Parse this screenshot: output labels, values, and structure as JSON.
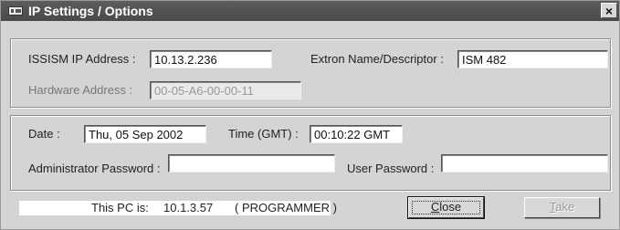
{
  "window": {
    "title": "IP Settings / Options",
    "close_glyph": "×"
  },
  "network": {
    "ip_label": "ISSISM IP Address :",
    "ip_value": "10.13.2.236",
    "name_label": "Extron Name/Descriptor :",
    "name_value": "ISM 482",
    "hw_label": "Hardware Address :",
    "hw_value": "00-05-A6-00-00-11"
  },
  "clock": {
    "date_label": "Date :",
    "date_value": "Thu, 05 Sep 2002",
    "time_label": "Time (GMT) :",
    "time_value": "00:10:22 GMT",
    "admin_pw_label": "Administrator Password :",
    "admin_pw_value": "",
    "user_pw_label": "User Password :",
    "user_pw_value": ""
  },
  "status": {
    "prefix": "This PC is:",
    "ip": "10.1.3.57",
    "role": "( PROGRAMMER )"
  },
  "buttons": {
    "close_first": "C",
    "close_rest": "lose",
    "take_first": "T",
    "take_rest": "ake"
  }
}
